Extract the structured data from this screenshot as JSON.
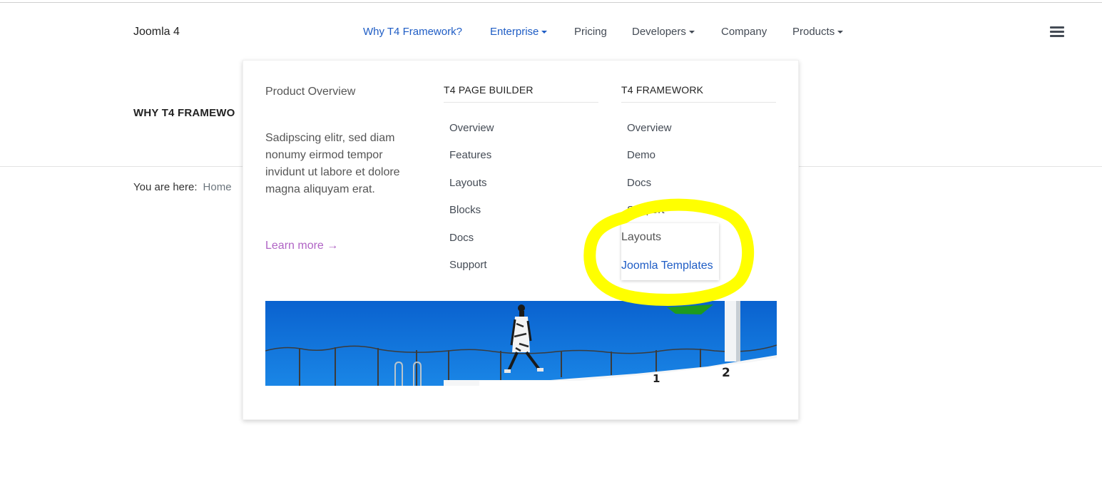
{
  "header": {
    "brand": "Joomla 4",
    "nav": [
      {
        "label": "Why T4 Framework?",
        "active": true,
        "dropdown": false
      },
      {
        "label": "Enterprise",
        "active": true,
        "dropdown": true
      },
      {
        "label": "Pricing",
        "active": false,
        "dropdown": false
      },
      {
        "label": "Developers",
        "active": false,
        "dropdown": true
      },
      {
        "label": "Company",
        "active": false,
        "dropdown": false
      },
      {
        "label": "Products",
        "active": false,
        "dropdown": true
      }
    ],
    "menu_icon": "hamburger-icon"
  },
  "page": {
    "heading": "WHY T4 FRAMEWO",
    "breadcrumb_label": "You are here:",
    "breadcrumb_home": "Home"
  },
  "mega_menu": {
    "overview_title": "Product Overview",
    "overview_text": "Sadipscing elitr, sed diam nonumy eirmod tempor invidunt ut labore et dolore magna aliquyam erat.",
    "learn_more": "Learn more →",
    "page_builder": {
      "title": "T4 PAGE BUILDER",
      "items": [
        "Overview",
        "Features",
        "Layouts",
        "Blocks",
        "Docs",
        "Support"
      ]
    },
    "framework": {
      "title": "T4 FRAMEWORK",
      "items": [
        "Overview",
        "Demo",
        "Docs",
        "Support"
      ]
    },
    "support_submenu": [
      "Layouts",
      "Joomla Templates"
    ],
    "banner": "photo-banner"
  },
  "colors": {
    "link_active": "#1f5dc5",
    "text": "#444b55",
    "learn_more": "#b064c5",
    "highlight": "#ffff00",
    "sky": "#0b6fd6"
  }
}
